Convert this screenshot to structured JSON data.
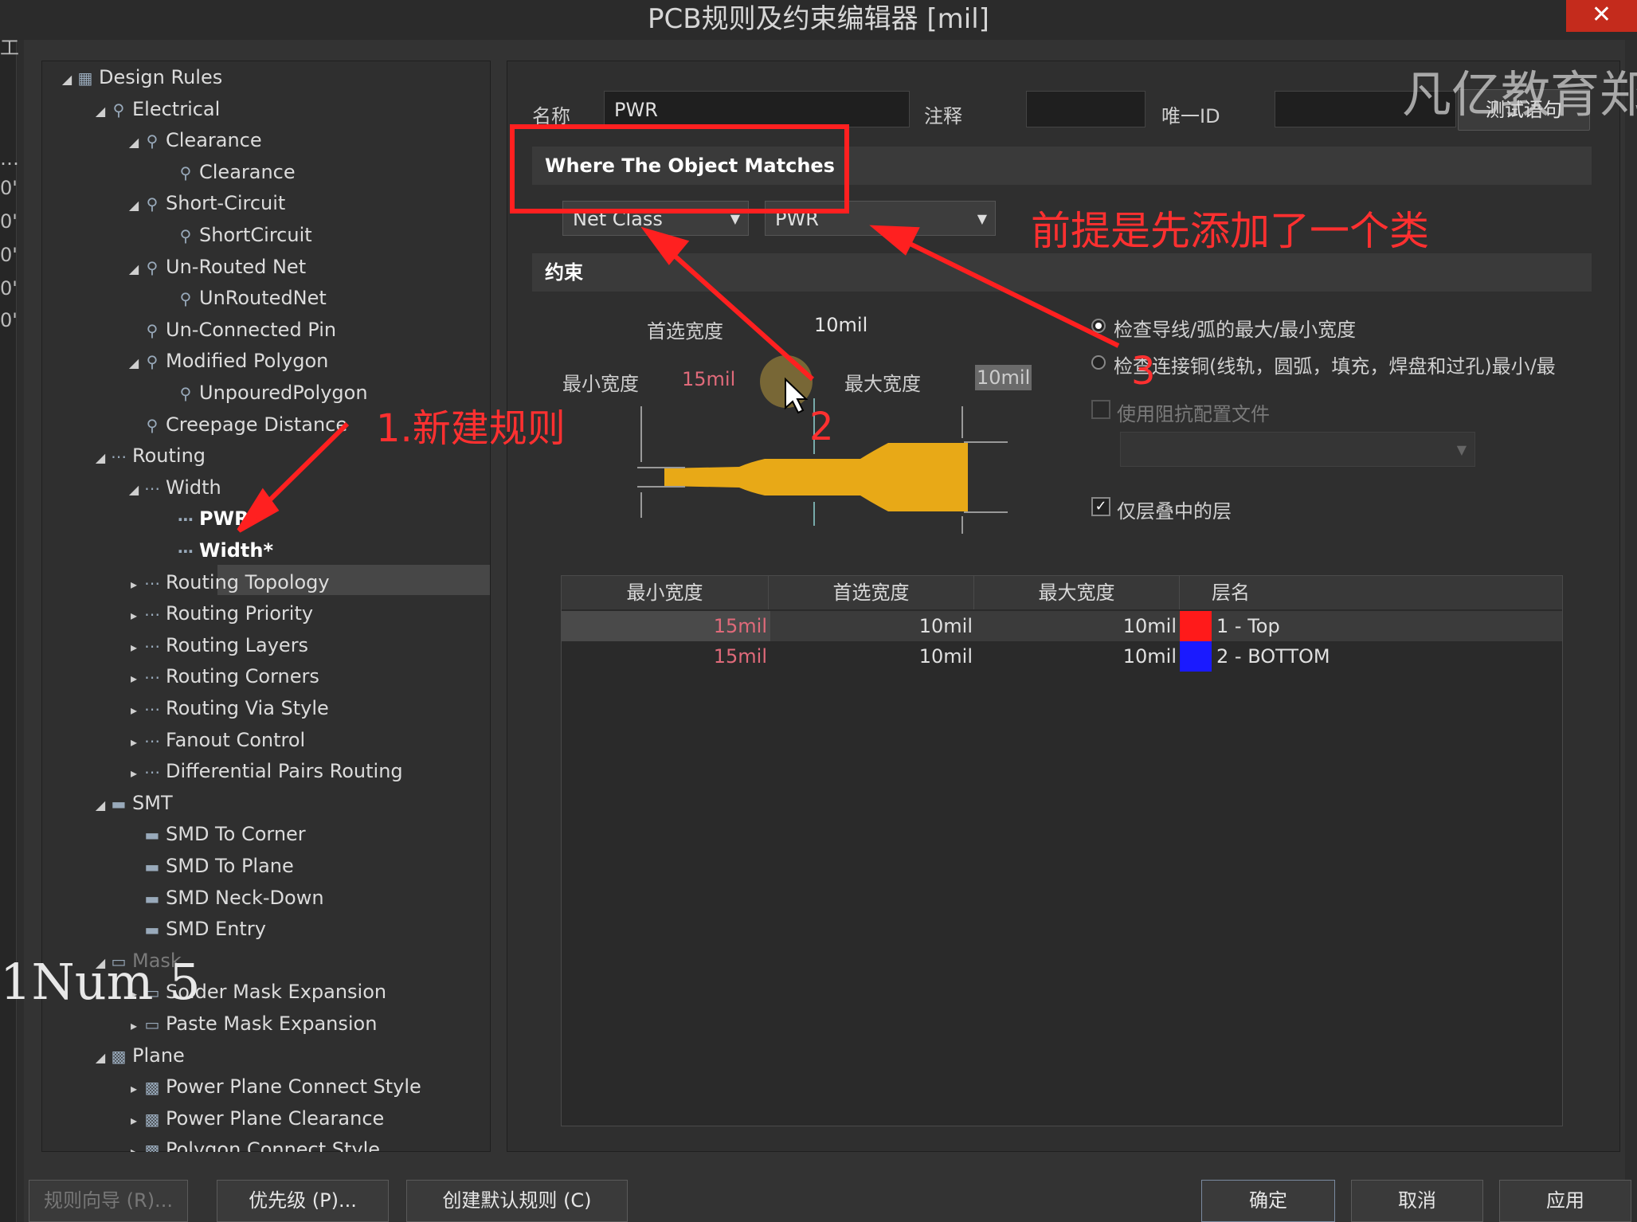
{
  "window": {
    "title": "PCB规则及约束编辑器 [mil]",
    "close_label": "✕"
  },
  "left_edge": [
    "工",
    "…",
    "0'",
    "0'",
    "0'",
    "0'",
    "0'"
  ],
  "tree": {
    "items": [
      {
        "label": "Design Rules",
        "icon": "design-rules-icon"
      },
      {
        "label": "Electrical",
        "icon": "electrical-icon"
      },
      {
        "label": "Clearance",
        "icon": "rule-icon"
      },
      {
        "label": "Clearance",
        "icon": "rule-icon"
      },
      {
        "label": "Short-Circuit",
        "icon": "rule-icon"
      },
      {
        "label": "ShortCircuit",
        "icon": "rule-icon"
      },
      {
        "label": "Un-Routed Net",
        "icon": "rule-icon"
      },
      {
        "label": "UnRoutedNet",
        "icon": "rule-icon"
      },
      {
        "label": "Un-Connected Pin",
        "icon": "rule-icon"
      },
      {
        "label": "Modified Polygon",
        "icon": "rule-icon"
      },
      {
        "label": "UnpouredPolygon",
        "icon": "rule-icon"
      },
      {
        "label": "Creepage Distance",
        "icon": "rule-icon"
      },
      {
        "label": "Routing",
        "icon": "routing-icon"
      },
      {
        "label": "Width",
        "icon": "routing-icon"
      },
      {
        "label": "PWR",
        "icon": "routing-icon"
      },
      {
        "label": "Width*",
        "icon": "routing-icon"
      },
      {
        "label": "Routing Topology",
        "icon": "routing-icon"
      },
      {
        "label": "Routing Priority",
        "icon": "routing-icon"
      },
      {
        "label": "Routing Layers",
        "icon": "routing-icon"
      },
      {
        "label": "Routing Corners",
        "icon": "routing-icon"
      },
      {
        "label": "Routing Via Style",
        "icon": "routing-icon"
      },
      {
        "label": "Fanout Control",
        "icon": "routing-icon"
      },
      {
        "label": "Differential Pairs Routing",
        "icon": "routing-icon"
      },
      {
        "label": "SMT",
        "icon": "smt-icon"
      },
      {
        "label": "SMD To Corner",
        "icon": "smt-icon"
      },
      {
        "label": "SMD To Plane",
        "icon": "smt-icon"
      },
      {
        "label": "SMD Neck-Down",
        "icon": "smt-icon"
      },
      {
        "label": "SMD Entry",
        "icon": "smt-icon"
      },
      {
        "label": "Mask",
        "icon": "mask-icon"
      },
      {
        "label": "Solder Mask Expansion",
        "icon": "mask-icon"
      },
      {
        "label": "Paste Mask Expansion",
        "icon": "mask-icon"
      },
      {
        "label": "Plane",
        "icon": "plane-icon"
      },
      {
        "label": "Power Plane Connect Style",
        "icon": "plane-icon"
      },
      {
        "label": "Power Plane Clearance",
        "icon": "plane-icon"
      },
      {
        "label": "Polygon Connect Style",
        "icon": "plane-icon"
      }
    ]
  },
  "rule_header": {
    "name_label": "名称",
    "name_value": "PWR",
    "comment_label": "注释",
    "comment_value": "",
    "uid_label": "唯一ID",
    "uid_value": "",
    "test_button": "测试语句"
  },
  "match": {
    "section_title": "Where The Object Matches",
    "type_value": "Net Class",
    "class_value": "PWR"
  },
  "constraints": {
    "section_title": "约束",
    "preferred_label": "首选宽度",
    "preferred_value": "10mil",
    "min_label": "最小宽度",
    "min_value": "15mil",
    "max_label": "最大宽度",
    "max_value": "10mil",
    "radio1_label": "检查导线/弧的最大/最小宽度",
    "radio2_label": "检查连接铜(线轨，圆弧，填充，焊盘和过孔)最小/最",
    "impedance_label": "使用阻抗配置文件",
    "stack_only_label": "仅层叠中的层",
    "trace_color": "#e8a917"
  },
  "grid": {
    "headers": [
      "最小宽度",
      "首选宽度",
      "最大宽度",
      "层名"
    ],
    "rows": [
      {
        "min": "15mil",
        "pref": "10mil",
        "max": "10mil",
        "layer": "1 - Top",
        "color": "#ff1a1a"
      },
      {
        "min": "15mil",
        "pref": "10mil",
        "max": "10mil",
        "layer": "2 - BOTTOM",
        "color": "#1a1aff"
      }
    ]
  },
  "buttons": {
    "wizard": "规则向导 (R)...",
    "priority": "优先级 (P)...",
    "create_default": "创建默认规则 (C)",
    "ok": "确定",
    "cancel": "取消",
    "apply": "应用"
  },
  "annotations": {
    "new_rule": "1.新建规则",
    "prereq": "前提是先添加了一个类",
    "num2": "2",
    "num3": "3",
    "watermark": "凡亿教育郑",
    "overlay": "1Num 5"
  },
  "colors": {
    "highlight_red": "#ff2020",
    "annotation_red": "#ff3030"
  }
}
